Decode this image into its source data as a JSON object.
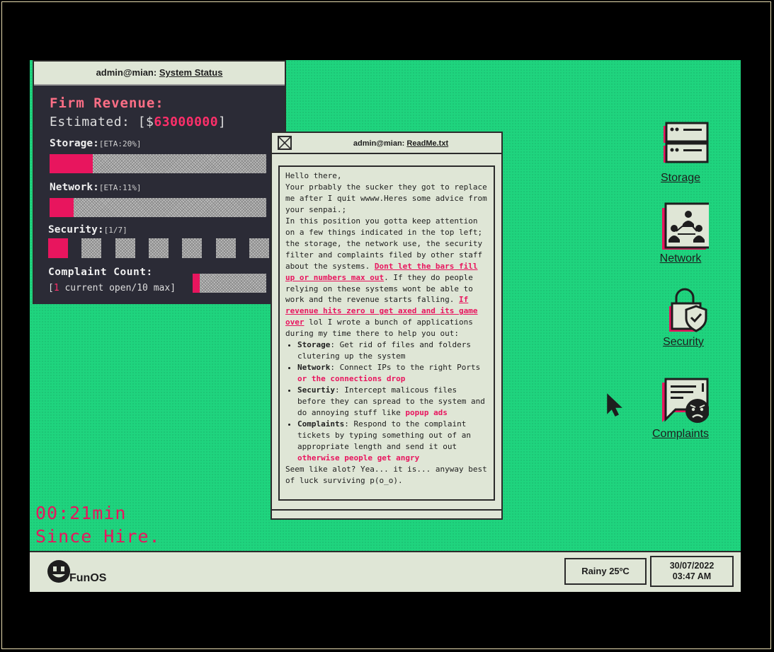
{
  "colors": {
    "desktop": "#1fd47e",
    "accent": "#e8155e",
    "panel": "#2b2b36",
    "window": "#dfe6d6"
  },
  "status_window": {
    "title_prefix": "admin@mian:",
    "title_file": "System Status",
    "firm_revenue_label": "Firm Revenue:",
    "estimated_prefix": "Estimated: [$",
    "estimated_value": "63000000",
    "estimated_suffix": "]",
    "storage": {
      "label": "Storage:",
      "eta": "[ETA:20%]",
      "fill_percent": 20
    },
    "network": {
      "label": "Network:",
      "eta": "[ETA:11%]",
      "fill_percent": 11
    },
    "security": {
      "label": "Security:",
      "eta": "[1/7]",
      "active": 1,
      "total": 7
    },
    "complaint": {
      "label": "Complaint Count:",
      "open_prefix": "[",
      "open_count": "1",
      "open_suffix": " current open/10 max]",
      "fill_percent": 10
    }
  },
  "readme_window": {
    "title_prefix": "admin@mian:",
    "title_file": "ReadMe.txt",
    "line1": "Hello there,",
    "line2": "Your prbably the sucker they got to replace me after I quit wwww.Heres some advice from your senpai.;",
    "line3": "In this position you gotta keep attention on a few things indicated in the top left; the storage, the network use, the security filter and complaints filed by other staff about the systems.",
    "warn1": "Dont let the bars fill up or numbers max out",
    "mid1": ". If they do people relying on these systems wont be able to work and the revenue starts falling. ",
    "warn2": "If revenue hits zero u get axed and its game over",
    "mid2": " lol I wrote a bunch of applications during my time there to help you out:",
    "bullets": [
      {
        "name": "Storage",
        "text": ": Get rid of files and folders clutering up the system",
        "hot": ""
      },
      {
        "name": "Network",
        "text": ": Connect IPs to the right Ports ",
        "hot": "or the connections drop"
      },
      {
        "name": "Securtiy",
        "text": ": Intercept malicous files before they can spread to the system and do annoying stuff like ",
        "hot": "popup ads"
      },
      {
        "name": "Complaints",
        "text": ": Respond to the complaint tickets by typing something out of an appropriate length and send it out ",
        "hot": "otherwise people get angry"
      }
    ],
    "closing": "Seem like alot? Yea... it is... anyway best of luck surviving p(o_o)."
  },
  "desktop_icons": [
    {
      "label": "Storage",
      "icon": "server-icon"
    },
    {
      "label": "Network",
      "icon": "network-icon"
    },
    {
      "label": "Security",
      "icon": "lock-shield-icon"
    },
    {
      "label": "Complaints",
      "icon": "angry-chat-icon"
    }
  ],
  "timer": {
    "time": "00:21min",
    "caption": "Since Hire."
  },
  "taskbar": {
    "os_name": "FunOS",
    "weather": "Rainy 25ºC",
    "date": "30/07/2022",
    "time": "03:47 AM"
  }
}
